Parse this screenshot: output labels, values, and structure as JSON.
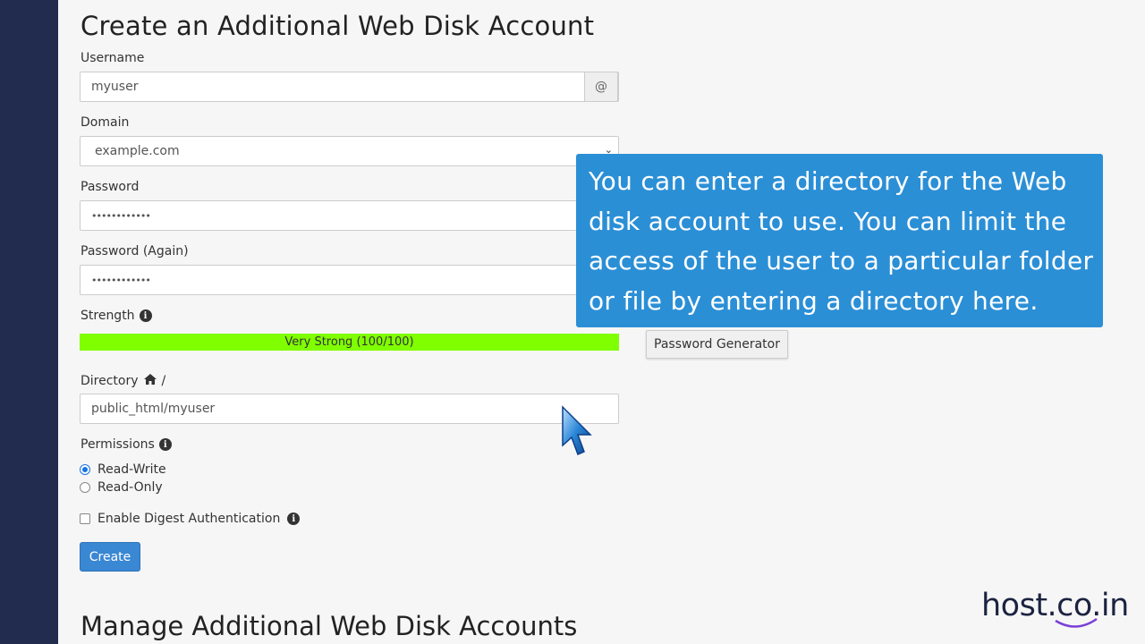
{
  "form": {
    "heading": "Create an Additional Web Disk Account",
    "username_label": "Username",
    "username_value": "myuser",
    "username_addon": "@",
    "domain_label": "Domain",
    "domain_value": "example.com",
    "password_label": "Password",
    "password_value": "••••••••••••",
    "password_again_label": "Password (Again)",
    "password_again_value": "••••••••••••",
    "strength_label": "Strength",
    "strength_text": "Very Strong (100/100)",
    "strength_percent": 100,
    "password_generator_label": "Password Generator",
    "directory_label": "Directory",
    "directory_sep": "/",
    "directory_value": "public_html/myuser",
    "permissions_label": "Permissions",
    "permissions_options": [
      "Read-Write",
      "Read-Only"
    ],
    "permissions_selected": "Read-Write",
    "digest_label": "Enable Digest Authentication",
    "digest_checked": false,
    "create_label": "Create"
  },
  "manage": {
    "heading": "Manage Additional Web Disk Accounts"
  },
  "tooltip": {
    "lines": [
      "You can enter a directory for the Web",
      "disk account to use. You can limit the",
      "access of the user to a particular folder",
      "or file by entering a directory here."
    ]
  },
  "brand": {
    "text": "host.co.in"
  },
  "colors": {
    "sidebar": "#222c4f",
    "strength_bar": "#7fff00",
    "tooltip": "#2b8fd6",
    "create_button": "#3a87d3"
  },
  "icons": [
    "info-icon",
    "home-icon",
    "cursor-arrow-icon",
    "chevron-down-icon"
  ]
}
